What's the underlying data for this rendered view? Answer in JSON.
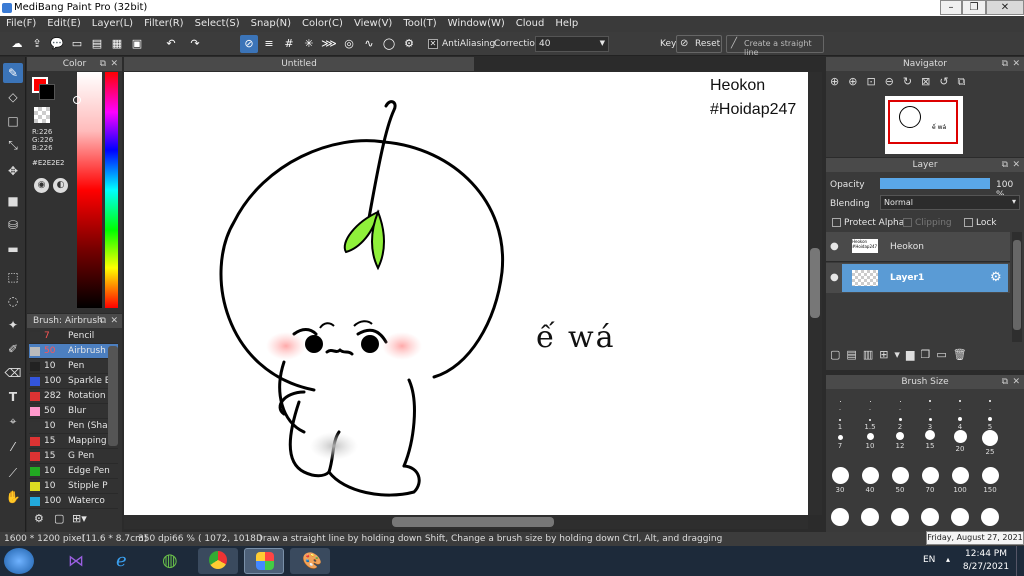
{
  "window": {
    "title": "MediBang Paint Pro (32bit)"
  },
  "menu": [
    "File(F)",
    "Edit(E)",
    "Layer(L)",
    "Filter(R)",
    "Select(S)",
    "Snap(N)",
    "Color(C)",
    "View(V)",
    "Tool(T)",
    "Window(W)",
    "Cloud",
    "Help"
  ],
  "toolbar": {
    "antialiasing_label": "AntiAliasing",
    "correction_label": "Correction",
    "correction_value": "40",
    "key_label": "Key",
    "reset_label": "Reset",
    "straight_line_label": "Create a straight line"
  },
  "color_panel": {
    "title": "Color",
    "r": "R:226",
    "g": "G:226",
    "b": "B:226",
    "hex": "#E2E2E2",
    "fg_color": "#ff0000",
    "bg_color": "#ffffff"
  },
  "brush_panel": {
    "title": "Brush: Airbrush",
    "items": [
      {
        "size": "7",
        "name": "Pencil",
        "color": "#333333"
      },
      {
        "size": "50",
        "name": "Airbrush",
        "color": "#bbbbbb"
      },
      {
        "size": "10",
        "name": "Pen",
        "color": "#222222"
      },
      {
        "size": "100",
        "name": "Sparkle B",
        "color": "#3355dd"
      },
      {
        "size": "282",
        "name": "Rotation",
        "color": "#dd3333"
      },
      {
        "size": "50",
        "name": "Blur",
        "color": "#ff99cc"
      },
      {
        "size": "10",
        "name": "Pen (Sha",
        "color": "#333333"
      },
      {
        "size": "15",
        "name": "Mapping",
        "color": "#dd3333"
      },
      {
        "size": "15",
        "name": "G Pen",
        "color": "#dd3333"
      },
      {
        "size": "10",
        "name": "Edge Pen",
        "color": "#22aa22"
      },
      {
        "size": "10",
        "name": "Stipple P",
        "color": "#dddd22"
      },
      {
        "size": "100",
        "name": "Waterco",
        "color": "#22aadd"
      }
    ]
  },
  "canvas": {
    "tab_title": "Untitled",
    "text_top_line1": "Heokon",
    "text_top_line2": "#Hoidap247",
    "text_handwritten": "ế wá"
  },
  "navigator": {
    "title": "Navigator",
    "thumb_text": "ế wá"
  },
  "layer_panel": {
    "title": "Layer",
    "opacity_label": "Opacity",
    "opacity_value": "100 %",
    "opacity_level": 1.0,
    "blending_label": "Blending",
    "blending_value": "Normal",
    "protect_alpha_label": "Protect Alpha",
    "clipping_label": "Clipping",
    "lock_label": "Lock",
    "layers": [
      {
        "name": "Heokon",
        "thumb_text": "Heokon #Hoidap247",
        "selected": false
      },
      {
        "name": "Layer1",
        "thumb_text": "",
        "selected": true
      }
    ]
  },
  "brush_size_panel": {
    "title": "Brush Size",
    "row1": [
      ".",
      ".",
      ".",
      ".",
      ".",
      "."
    ],
    "row2": [
      "1",
      "1.5",
      "2",
      "3",
      "4",
      "5"
    ],
    "row3": [
      "7",
      "10",
      "12",
      "15",
      "20",
      "25"
    ],
    "row4": [
      "30",
      "40",
      "50",
      "70",
      "100",
      "150"
    ]
  },
  "status": {
    "dimensions": "1600 * 1200 pixel",
    "size_cm": "(11.6 * 8.7cm)",
    "dpi": "350 dpi",
    "zoom": "66 %",
    "coords": "( 1072, 1018 )",
    "hint": "Draw a straight line by holding down Shift, Change a brush size by holding down Ctrl, Alt, and dragging"
  },
  "taskbar": {
    "date_tooltip": "Friday, August 27, 2021",
    "lang": "EN",
    "time": "12:44 PM",
    "date": "8/27/2021"
  }
}
